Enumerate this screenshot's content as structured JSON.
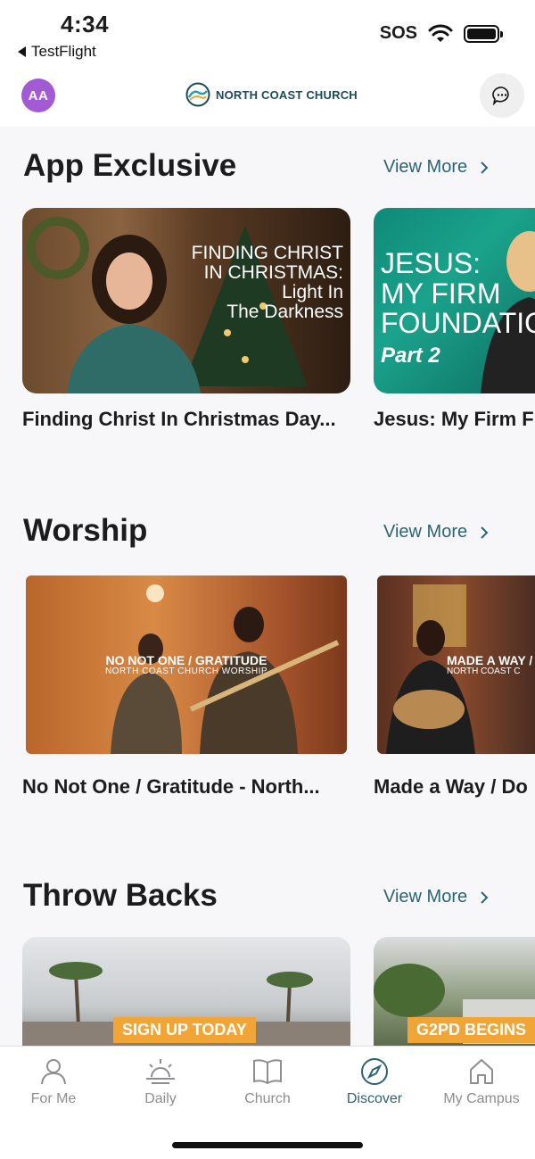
{
  "status": {
    "time": "4:34",
    "back_app": "TestFlight",
    "sos": "SOS"
  },
  "header": {
    "avatar_initials": "AA",
    "logo_text": "NORTH COAST CHURCH"
  },
  "sections": [
    {
      "title": "App Exclusive",
      "view_more": "View More",
      "cards": [
        {
          "title": "Finding Christ In Christmas Day...",
          "overlay": [
            "FINDING CHRIST",
            "IN CHRISTMAS:",
            "Light In",
            "The Darkness"
          ]
        },
        {
          "title": "Jesus: My Firm F",
          "overlay": [
            "JESUS:",
            "MY FIRM",
            "FOUNDATIO",
            "Part 2"
          ]
        }
      ]
    },
    {
      "title": "Worship",
      "view_more": "View More",
      "cards": [
        {
          "title": "No Not One / Gratitude - North...",
          "overlay": [
            "NO NOT ONE / GRATITUDE",
            "NORTH COAST CHURCH WORSHIP"
          ]
        },
        {
          "title": "Made a Way / Do",
          "overlay": [
            "MADE A WAY /",
            "NORTH COAST C"
          ]
        }
      ]
    },
    {
      "title": "Throw Backs",
      "view_more": "View More",
      "cards": [
        {
          "banner": "SIGN UP TODAY"
        },
        {
          "banner": "G2PD BEGINS"
        }
      ]
    }
  ],
  "tabs": [
    {
      "label": "For Me",
      "icon": "person-icon",
      "active": false
    },
    {
      "label": "Daily",
      "icon": "sunrise-icon",
      "active": false
    },
    {
      "label": "Church",
      "icon": "book-icon",
      "active": false
    },
    {
      "label": "Discover",
      "icon": "compass-icon",
      "active": true
    },
    {
      "label": "My Campus",
      "icon": "home-icon",
      "active": false
    }
  ],
  "colors": {
    "accent": "#2c6374",
    "avatar": "#a25bd2",
    "banner": "#f0a536",
    "inactive": "#8d8d92"
  }
}
